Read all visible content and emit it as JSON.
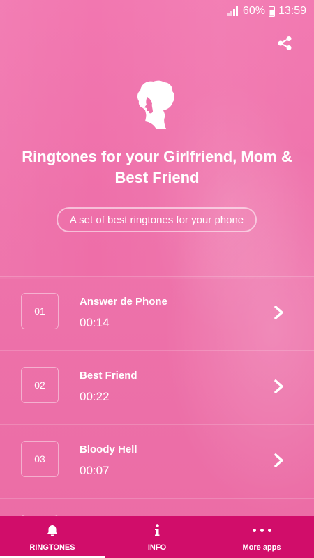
{
  "status_bar": {
    "battery": "60%",
    "time": "13:59"
  },
  "header": {
    "title": "Ringtones for your Girlfriend, Mom & Best Friend",
    "subtitle": "A set of best ringtones for your phone",
    "icons": [
      "share-icon",
      "woman-silhouette-logo"
    ]
  },
  "ringtones": [
    {
      "number": "01",
      "name": "Answer de Phone",
      "duration": "00:14"
    },
    {
      "number": "02",
      "name": "Best Friend",
      "duration": "00:22"
    },
    {
      "number": "03",
      "name": "Bloody Hell",
      "duration": "00:07"
    },
    {
      "number": "",
      "name": "",
      "duration": ""
    }
  ],
  "bottom_nav": {
    "items": [
      {
        "label": "RINGTONES",
        "icon": "bell-icon",
        "active": true
      },
      {
        "label": "INFO",
        "icon": "info-icon",
        "active": false
      },
      {
        "label": "More apps",
        "icon": "more-icon",
        "active": false
      }
    ]
  },
  "colors": {
    "background": "#ee72ab",
    "nav_bar": "#d10d6a",
    "text": "#ffffff"
  }
}
